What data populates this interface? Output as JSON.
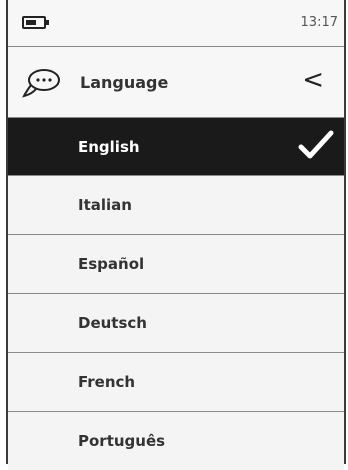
{
  "status": {
    "time": "13:17"
  },
  "header": {
    "title": "Language",
    "back_symbol": "<"
  },
  "languages": [
    {
      "label": "English",
      "selected": true
    },
    {
      "label": "Italian",
      "selected": false
    },
    {
      "label": "Español",
      "selected": false
    },
    {
      "label": "Deutsch",
      "selected": false
    },
    {
      "label": "French",
      "selected": false
    },
    {
      "label": "Português",
      "selected": false
    }
  ],
  "icons": {
    "battery": "battery-icon",
    "header": "speech-bubble-icon",
    "back": "back-arrow-icon",
    "selected": "checkmark-icon"
  }
}
